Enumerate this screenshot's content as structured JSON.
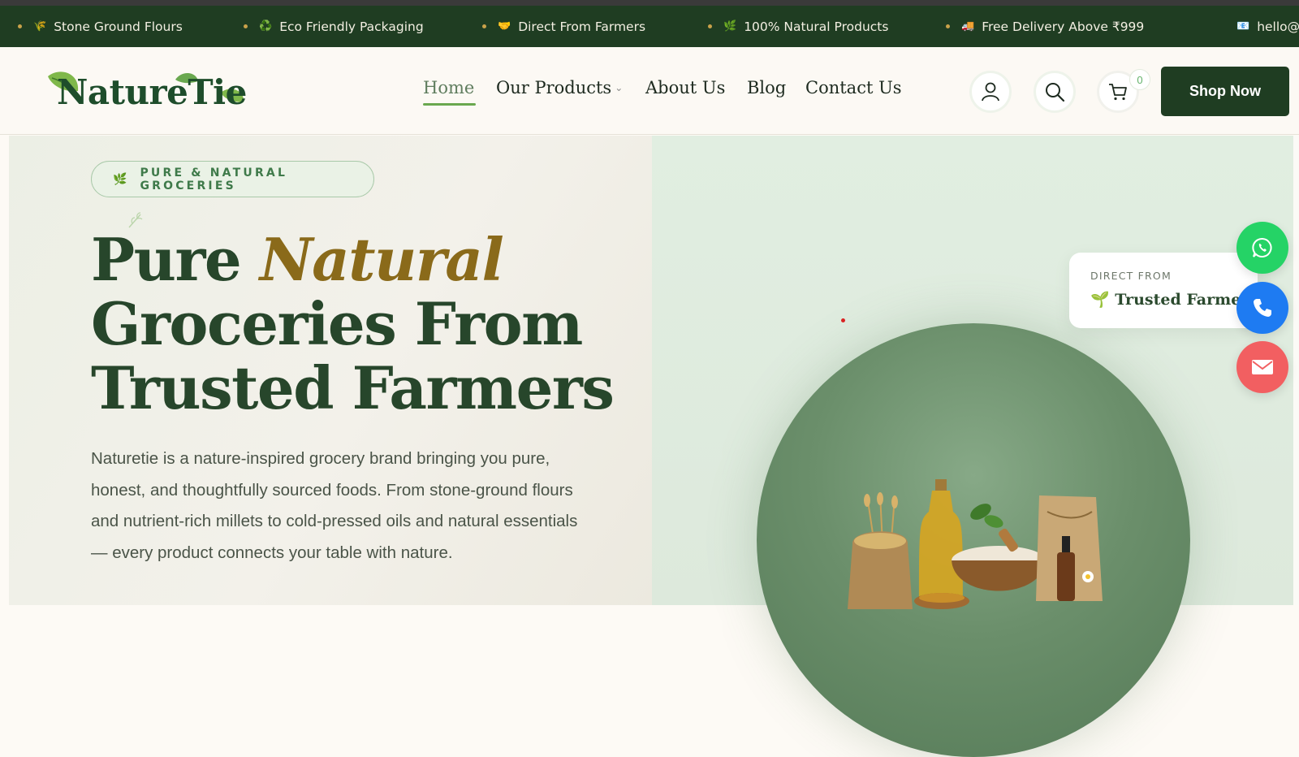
{
  "ticker": {
    "items": [
      {
        "emoji": "🌾",
        "text": "Stone Ground Flours"
      },
      {
        "emoji": "♻️",
        "text": "Eco Friendly Packaging"
      },
      {
        "emoji": "🤝",
        "text": "Direct From Farmers"
      },
      {
        "emoji": "🌿",
        "text": "100% Natural Products"
      },
      {
        "emoji": "🚚",
        "text": "Free Delivery Above ₹999"
      },
      {
        "emoji": "📧",
        "text": "hello@"
      }
    ]
  },
  "header": {
    "logo_text": "NatureTie",
    "nav": [
      {
        "label": "Home",
        "active": true
      },
      {
        "label": "Our Products",
        "has_dropdown": true
      },
      {
        "label": "About Us"
      },
      {
        "label": "Blog"
      },
      {
        "label": "Contact Us"
      }
    ],
    "cart_count": "0",
    "shop_button": "Shop Now"
  },
  "hero": {
    "pill_emoji": "🌿",
    "pill_text": "PURE & NATURAL GROCERIES",
    "headline_part1": "Pure ",
    "headline_accent": "Natural",
    "headline_line2": "Groceries From",
    "headline_line3": "Trusted Farmers",
    "description": "Naturetie is a nature-inspired grocery brand bringing you pure, honest, and thoughtfully sourced foods. From stone-ground flours and nutrient-rich millets to cold-pressed oils and natural essentials — every product connects your table with nature.",
    "card_small": "DIRECT FROM",
    "card_emoji": "🌱",
    "card_big": "Trusted Farmers"
  },
  "colors": {
    "brand_dark_green": "#1f3d22",
    "accent_gold": "#8a6a1a",
    "whatsapp": "#25d366",
    "phone": "#1e7bf2",
    "mail": "#f25f61"
  },
  "icons": [
    "user-icon",
    "search-icon",
    "cart-icon",
    "whatsapp-icon",
    "phone-icon",
    "mail-icon"
  ]
}
